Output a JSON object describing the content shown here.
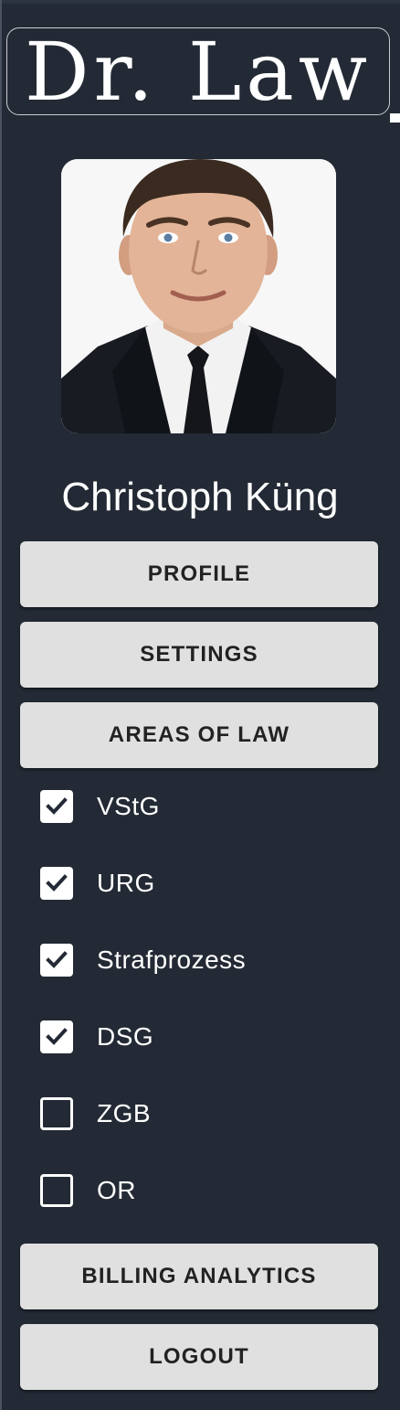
{
  "brand": {
    "logo_text": "Dr. Law"
  },
  "user": {
    "name": "Christoph Küng",
    "avatar_icon": "profile-photo"
  },
  "nav": {
    "profile_label": "PROFILE",
    "settings_label": "SETTINGS",
    "areas_label": "AREAS OF LAW",
    "billing_label": "BILLING ANALYTICS",
    "logout_label": "LOGOUT"
  },
  "areas": [
    {
      "label": "VStG",
      "checked": true
    },
    {
      "label": "URG",
      "checked": true
    },
    {
      "label": "Strafprozess",
      "checked": true
    },
    {
      "label": "DSG",
      "checked": true
    },
    {
      "label": "ZGB",
      "checked": false
    },
    {
      "label": "OR",
      "checked": false
    }
  ],
  "colors": {
    "sidebar_bg": "#232a35",
    "button_bg": "#e0e0e0",
    "button_text": "#222222",
    "text": "#ffffff"
  }
}
